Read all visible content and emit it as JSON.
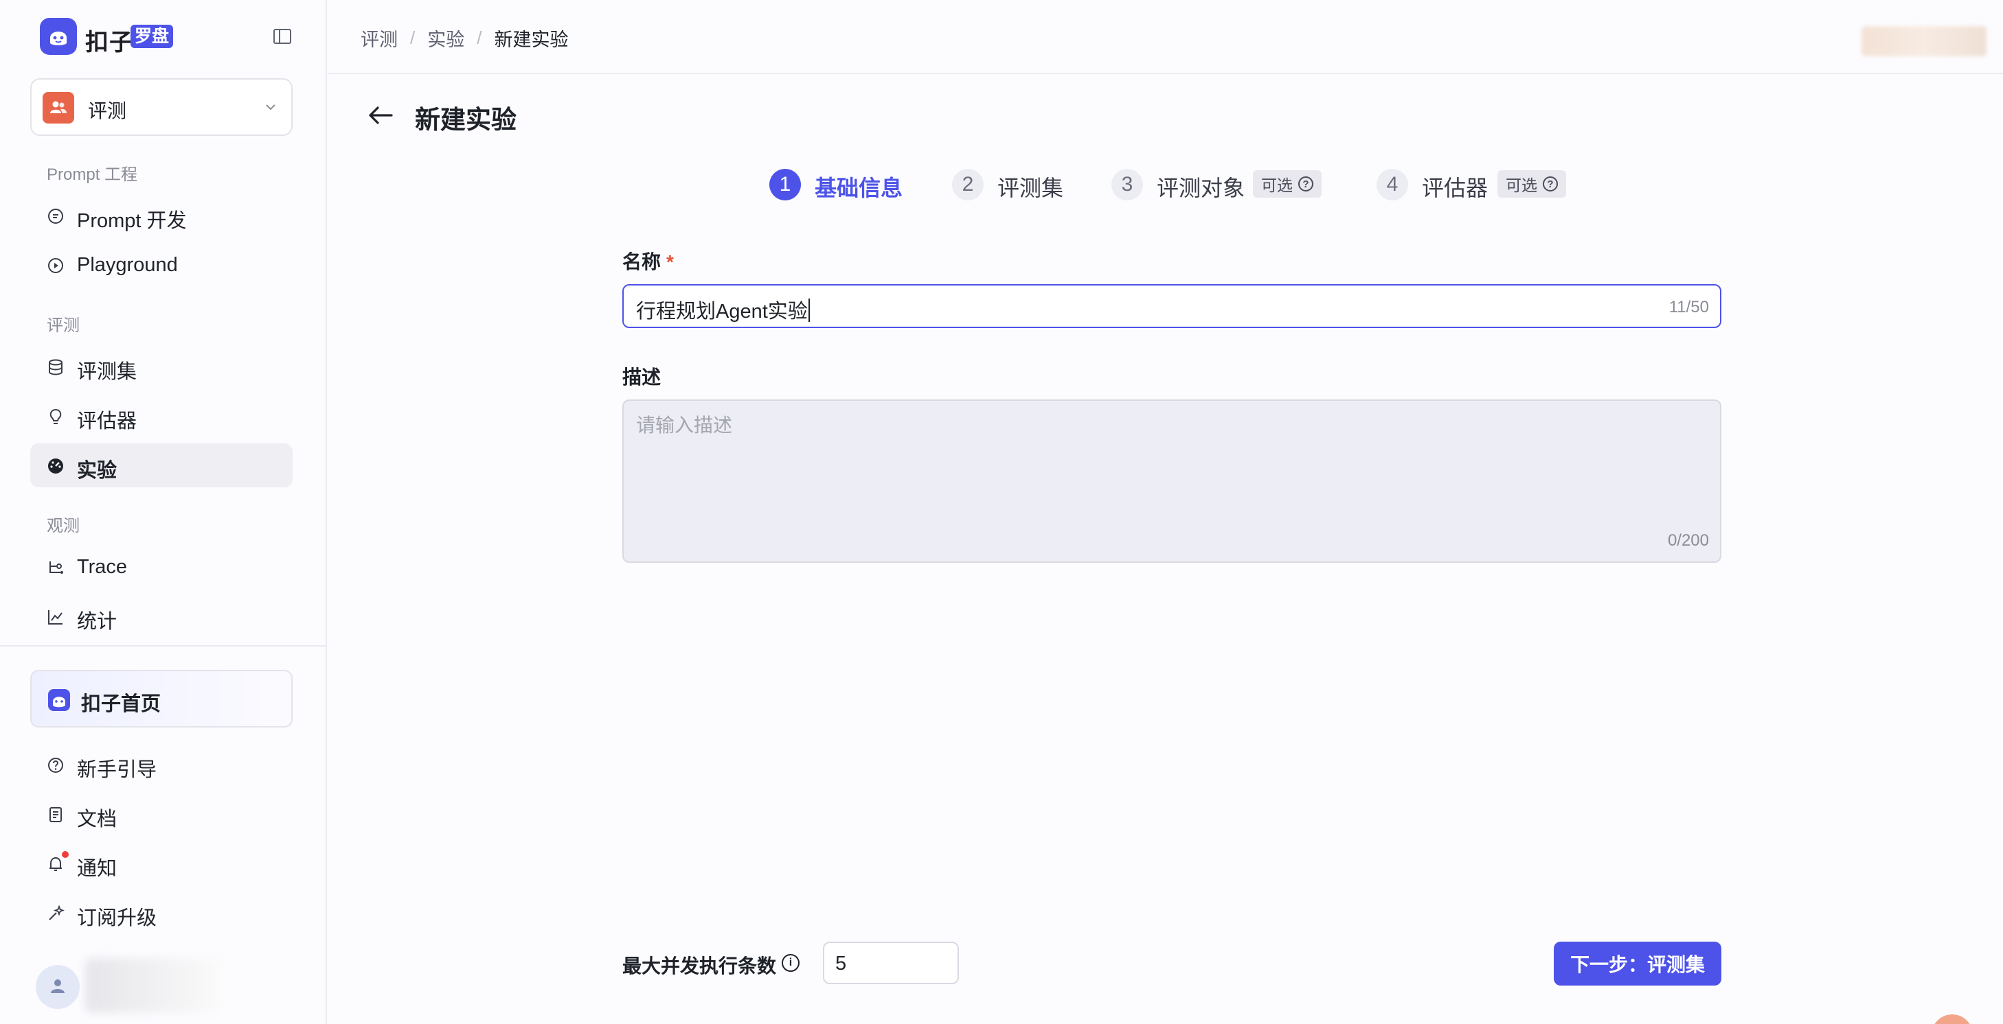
{
  "app": {
    "logo_text": "扣子",
    "logo_badge": "罗盘"
  },
  "space": {
    "name": "评测"
  },
  "sidebar": {
    "groups": [
      {
        "title": "Prompt 工程",
        "items": [
          {
            "label": "Prompt 开发",
            "icon": "chat-bubble-icon"
          },
          {
            "label": "Playground",
            "icon": "play-circle-icon"
          }
        ]
      },
      {
        "title": "评测",
        "items": [
          {
            "label": "评测集",
            "icon": "database-icon"
          },
          {
            "label": "评估器",
            "icon": "bulb-icon"
          },
          {
            "label": "实验",
            "icon": "gauge-icon",
            "active": true
          }
        ]
      },
      {
        "title": "观测",
        "items": [
          {
            "label": "Trace",
            "icon": "trace-icon"
          },
          {
            "label": "统计",
            "icon": "chart-icon"
          }
        ]
      }
    ],
    "home_label": "扣子首页",
    "bottom_items": [
      {
        "label": "新手引导",
        "icon": "help-circle-icon"
      },
      {
        "label": "文档",
        "icon": "document-icon"
      },
      {
        "label": "通知",
        "icon": "bell-icon"
      },
      {
        "label": "订阅升级",
        "icon": "sparkle-icon"
      }
    ]
  },
  "breadcrumb": [
    "评测",
    "实验",
    "新建实验"
  ],
  "page": {
    "title": "新建实验"
  },
  "steps": [
    {
      "num": "1",
      "label": "基础信息",
      "active": true
    },
    {
      "num": "2",
      "label": "评测集"
    },
    {
      "num": "3",
      "label": "评测对象",
      "optional": "可选"
    },
    {
      "num": "4",
      "label": "评估器",
      "optional": "可选"
    }
  ],
  "form": {
    "name_label": "名称",
    "required_mark": "*",
    "name_value": "行程规划Agent实验",
    "name_count": "11/50",
    "desc_label": "描述",
    "desc_placeholder": "请输入描述",
    "desc_count": "0/200",
    "concurrency_label": "最大并发执行条数",
    "concurrency_value": "5",
    "next_button": "下一步：评测集"
  },
  "colors": {
    "accent": "#4d53e8",
    "space_avatar": "#e8654a",
    "required": "#e8553b",
    "notification_dot": "#f23d3d"
  }
}
